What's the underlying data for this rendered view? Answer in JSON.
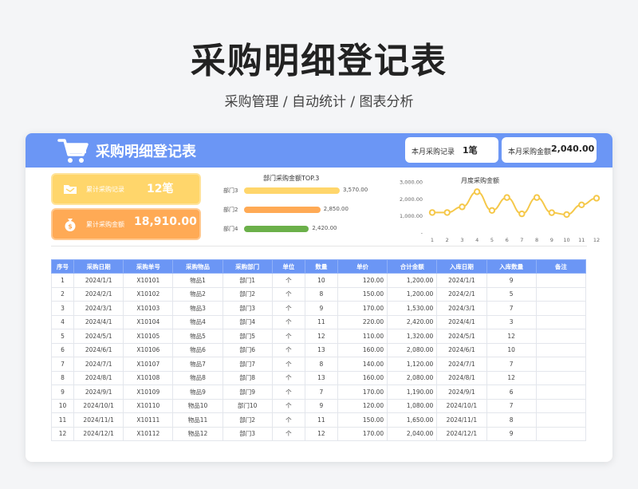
{
  "hero": {
    "title": "采购明细登记表",
    "subtitle": "采购管理 / 自动统计 / 图表分析"
  },
  "header": {
    "title": "采购明细登记表",
    "stats": [
      {
        "label": "本月采购记录",
        "value": "1笔"
      },
      {
        "label": "本月采购金额",
        "value": "2,040.00"
      }
    ]
  },
  "kpis": [
    {
      "label": "累计采购记录",
      "value": "12笔",
      "icon": "folder-icon"
    },
    {
      "label": "累计采购金额",
      "value": "18,910.00",
      "icon": "money-bag-icon"
    }
  ],
  "top3": {
    "title": "部门采购金额TOP.3",
    "items": [
      {
        "label": "部门3",
        "value": 3570,
        "display": "3,570.00",
        "color": "#ffd66b"
      },
      {
        "label": "部门2",
        "value": 2850,
        "display": "2,850.00",
        "color": "#ffaa55"
      },
      {
        "label": "部门4",
        "value": 2420,
        "display": "2,420.00",
        "color": "#6bb04a"
      }
    ]
  },
  "chart_data": {
    "type": "line",
    "title": "月度采购金额",
    "x": [
      1,
      2,
      3,
      4,
      5,
      6,
      7,
      8,
      9,
      10,
      11,
      12
    ],
    "values": [
      1200,
      1200,
      1530,
      2420,
      1320,
      2080,
      1120,
      2080,
      1190,
      1080,
      1650,
      2040
    ],
    "yticks": [
      "3,000.00",
      "2,000.00",
      "1,000.00",
      "-"
    ],
    "ylim": [
      0,
      3000
    ],
    "color": "#f5c84a"
  },
  "table": {
    "headers": [
      "序号",
      "采购日期",
      "采购单号",
      "采购物品",
      "采购部门",
      "单位",
      "数量",
      "单价",
      "合计金额",
      "入库日期",
      "入库数量",
      "备注"
    ],
    "rows": [
      [
        "1",
        "2024/1/1",
        "X10101",
        "物品1",
        "部门1",
        "个",
        "10",
        "120.00",
        "1,200.00",
        "2024/1/1",
        "9",
        ""
      ],
      [
        "2",
        "2024/2/1",
        "X10102",
        "物品2",
        "部门2",
        "个",
        "8",
        "150.00",
        "1,200.00",
        "2024/2/1",
        "5",
        ""
      ],
      [
        "3",
        "2024/3/1",
        "X10103",
        "物品3",
        "部门3",
        "个",
        "9",
        "170.00",
        "1,530.00",
        "2024/3/1",
        "7",
        ""
      ],
      [
        "4",
        "2024/4/1",
        "X10104",
        "物品4",
        "部门4",
        "个",
        "11",
        "220.00",
        "2,420.00",
        "2024/4/1",
        "3",
        ""
      ],
      [
        "5",
        "2024/5/1",
        "X10105",
        "物品5",
        "部门5",
        "个",
        "12",
        "110.00",
        "1,320.00",
        "2024/5/1",
        "12",
        ""
      ],
      [
        "6",
        "2024/6/1",
        "X10106",
        "物品6",
        "部门6",
        "个",
        "13",
        "160.00",
        "2,080.00",
        "2024/6/1",
        "10",
        ""
      ],
      [
        "7",
        "2024/7/1",
        "X10107",
        "物品7",
        "部门7",
        "个",
        "8",
        "140.00",
        "1,120.00",
        "2024/7/1",
        "7",
        ""
      ],
      [
        "8",
        "2024/8/1",
        "X10108",
        "物品8",
        "部门8",
        "个",
        "13",
        "160.00",
        "2,080.00",
        "2024/8/1",
        "12",
        ""
      ],
      [
        "9",
        "2024/9/1",
        "X10109",
        "物品9",
        "部门9",
        "个",
        "7",
        "170.00",
        "1,190.00",
        "2024/9/1",
        "6",
        ""
      ],
      [
        "10",
        "2024/10/1",
        "X10110",
        "物品10",
        "部门10",
        "个",
        "9",
        "120.00",
        "1,080.00",
        "2024/10/1",
        "7",
        ""
      ],
      [
        "11",
        "2024/11/1",
        "X10111",
        "物品11",
        "部门2",
        "个",
        "11",
        "150.00",
        "1,650.00",
        "2024/11/1",
        "8",
        ""
      ],
      [
        "12",
        "2024/12/1",
        "X10112",
        "物品12",
        "部门3",
        "个",
        "12",
        "170.00",
        "2,040.00",
        "2024/12/1",
        "9",
        ""
      ]
    ]
  }
}
